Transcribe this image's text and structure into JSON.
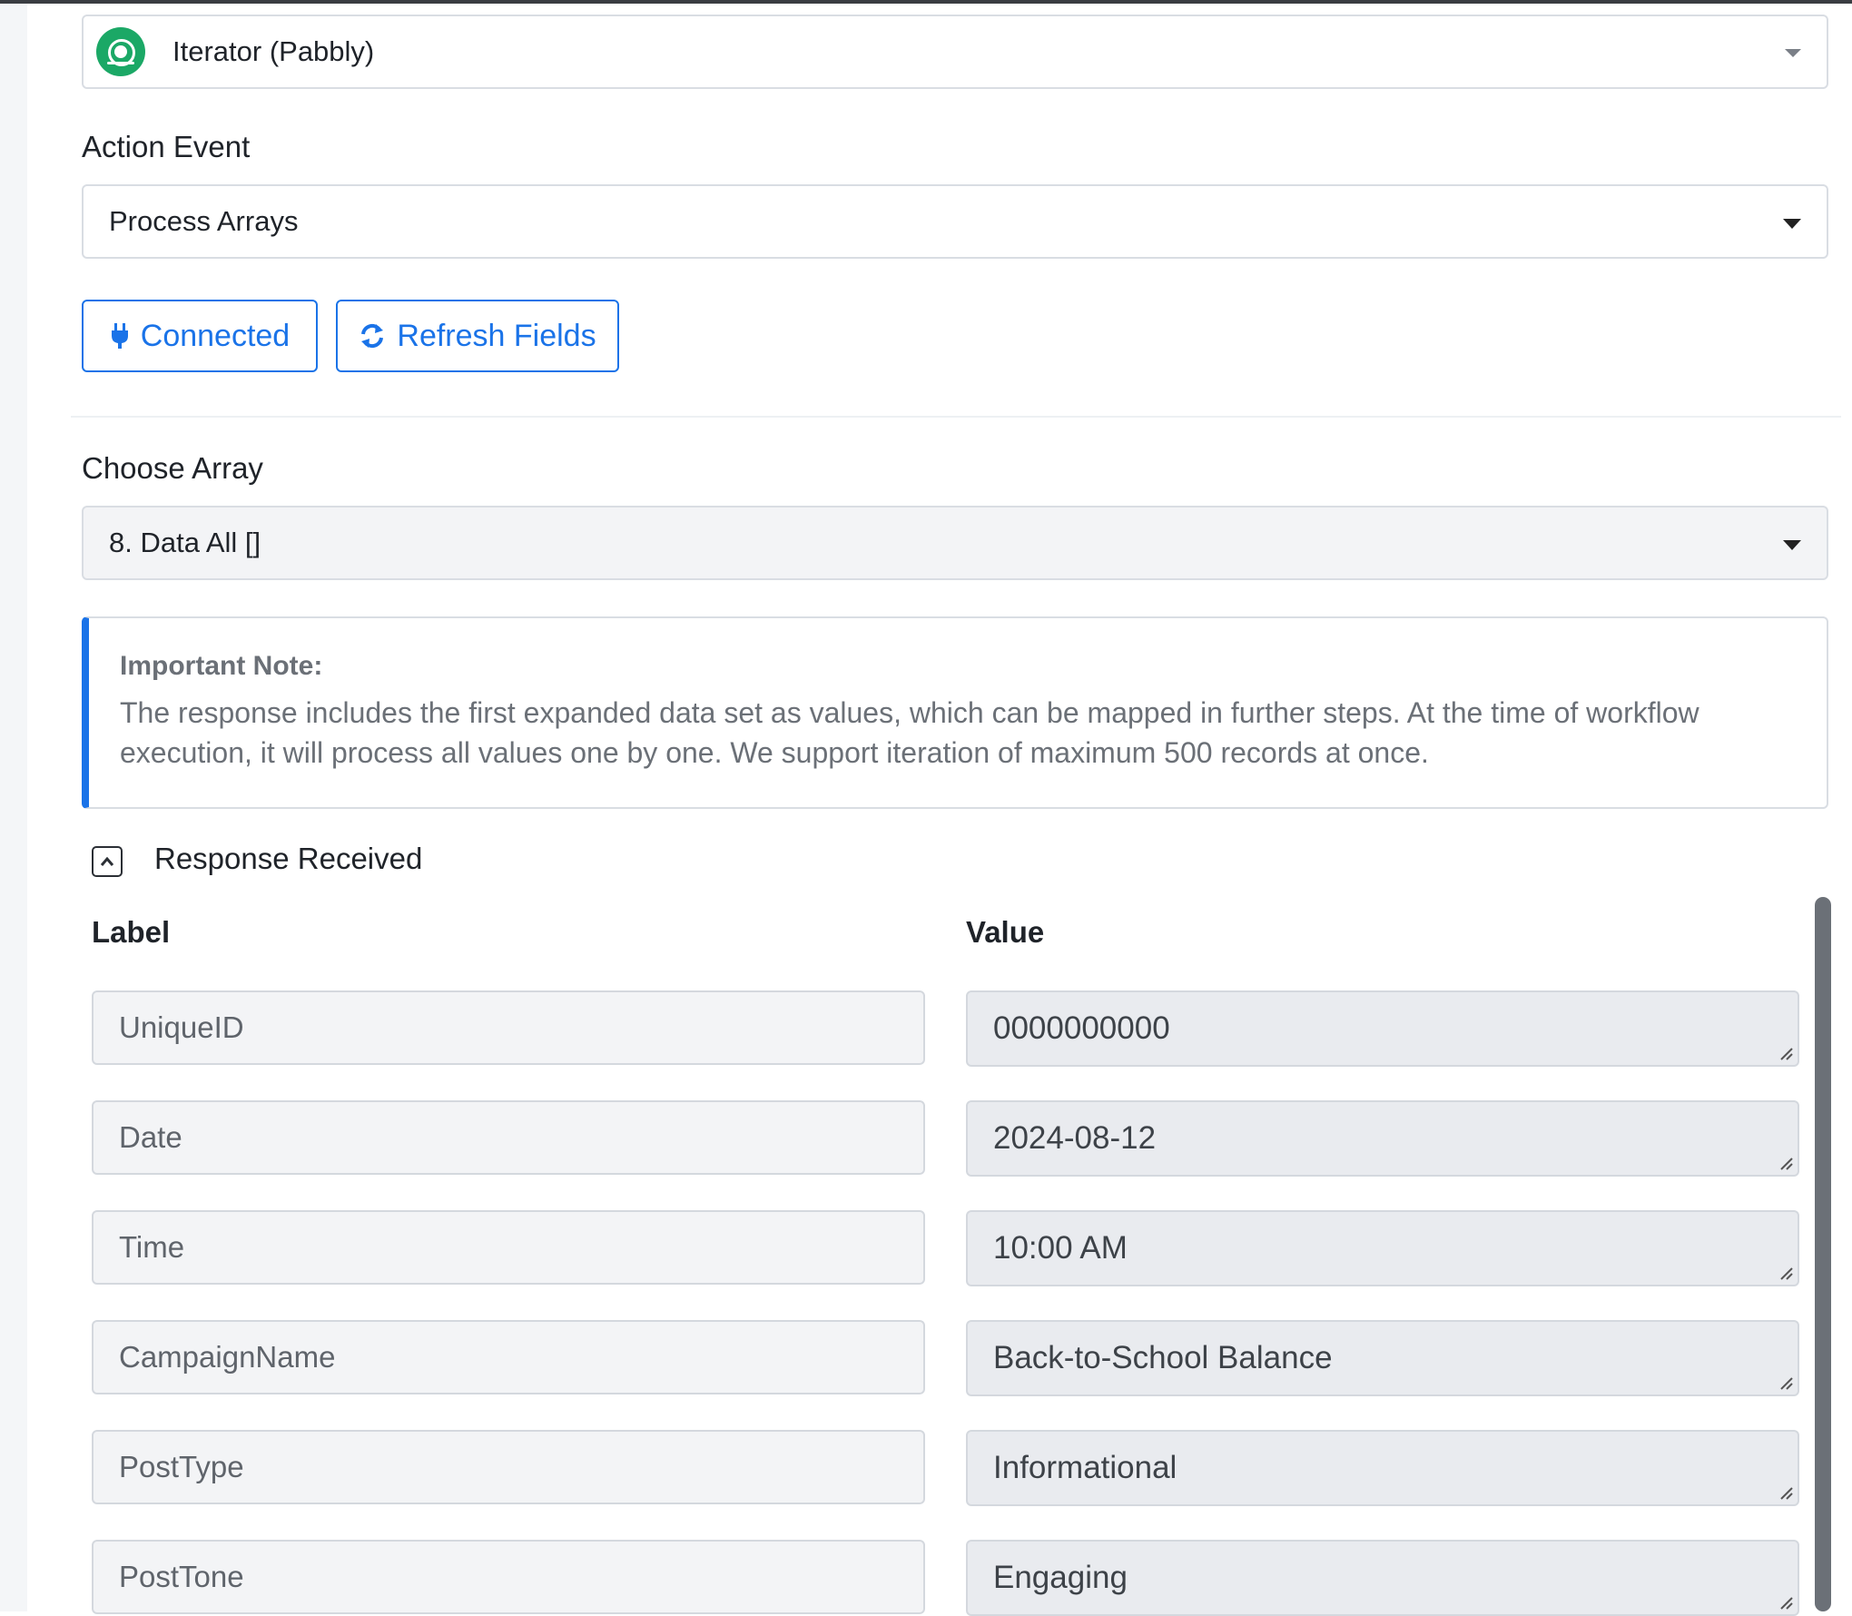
{
  "app_select": {
    "value": "Iterator (Pabbly)",
    "icon": "iterator-app-icon"
  },
  "action_event": {
    "label": "Action Event",
    "value": "Process Arrays"
  },
  "buttons": {
    "connected": "Connected",
    "refresh": "Refresh Fields"
  },
  "choose_array": {
    "label": "Choose Array",
    "value": "8. Data All []"
  },
  "note": {
    "title": "Important Note:",
    "body": "The response includes the first expanded data set as values, which can be mapped in further steps. At the time of workflow execution, it will process all values one by one. We support iteration of maximum 500 records at once."
  },
  "response": {
    "title": "Response Received",
    "label_header": "Label",
    "value_header": "Value",
    "rows": [
      {
        "label": "UniqueID",
        "value": "0000000000"
      },
      {
        "label": "Date",
        "value": "2024-08-12"
      },
      {
        "label": "Time",
        "value": "10:00 AM"
      },
      {
        "label": "CampaignName",
        "value": "Back-to-School Balance"
      },
      {
        "label": "PostType",
        "value": "Informational"
      },
      {
        "label": "PostTone",
        "value": "Engaging"
      }
    ]
  },
  "colors": {
    "accent": "#1a73e8",
    "app_icon": "#1ba866"
  }
}
